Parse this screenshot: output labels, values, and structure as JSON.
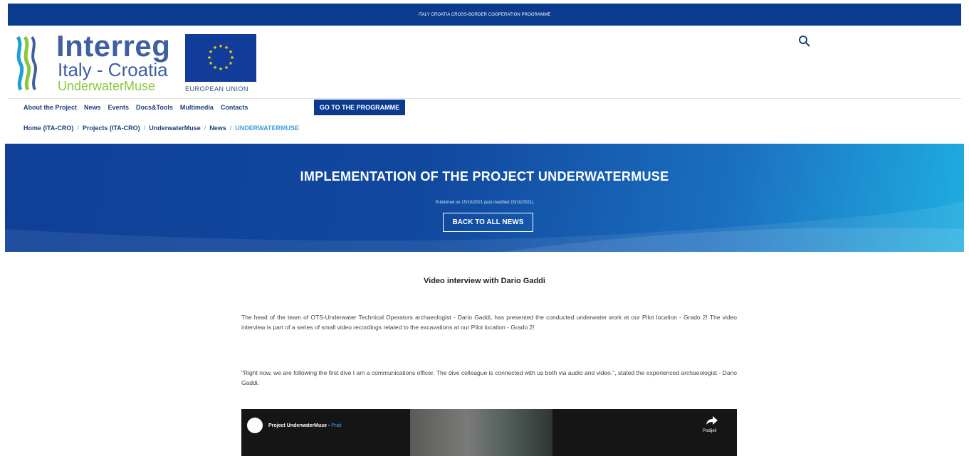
{
  "topbar": {
    "text": "ITALY CROATIA CROSS-BORDER COOPERATION PROGRAMME"
  },
  "logo": {
    "title": "Interreg",
    "subtitle": "Italy - Croatia",
    "project": "UnderwaterMuse",
    "eu_text": "EUROPEAN UNION"
  },
  "nav": {
    "items": [
      "About the Project",
      "News",
      "Events",
      "Docs&Tools",
      "Multimedia",
      "Contacts"
    ],
    "go_button": "GO TO THE PROGRAMME"
  },
  "breadcrumb": [
    "Home (ITA-CRO)",
    "Projects (ITA-CRO)",
    "UnderwaterMuse",
    "News",
    "UNDERWATERMUSE"
  ],
  "hero": {
    "title": "IMPLEMENTATION OF THE PROJECT UNDERWATERMUSE",
    "published": "Published on 15/10/2021 (last modified 15/10/2021)",
    "back_button": "BACK TO ALL NEWS"
  },
  "article": {
    "title": "Video interview with Dario Gaddi",
    "paragraphs": [
      "The head of the team of OTS-Underwater Technical Operators archaeologist - Dario Gaddi, has presented the conducted underwater work at our Pilot location - Grado 2! The video interview is part of a series of small video recordings related to the excavations at our Pilot location - Grado 2!",
      "\"Right now, we are following the first dive I am a communications officer. The dive colleague is connected with us both via audio and video.\", stated the experienced archaeologist - Dario Gaddi."
    ]
  },
  "video": {
    "channel": "Project UnderwaterMuse",
    "separator": " - ",
    "follow": "Prati",
    "share_label": "Podijeli"
  },
  "colors": {
    "brand_blue": "#0a3b8f",
    "link_blue": "#1a3f7a",
    "accent": "#3fa0d8",
    "logo_green": "#8cc63f"
  }
}
